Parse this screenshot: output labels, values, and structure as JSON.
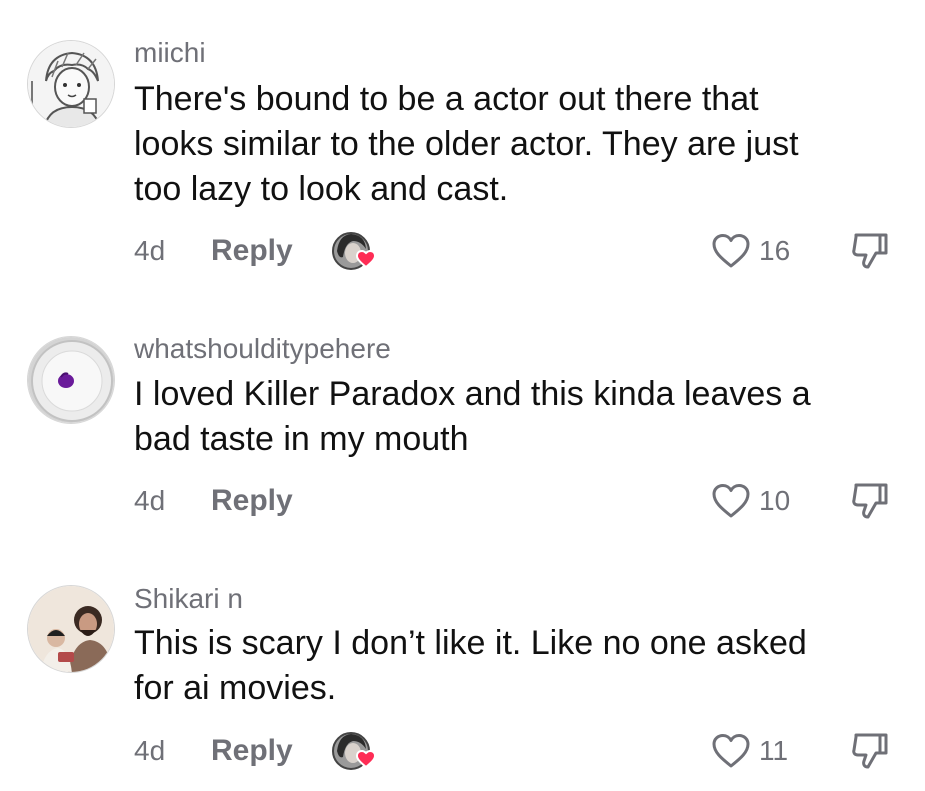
{
  "comments": [
    {
      "username": "miichi",
      "lines": [
        "There's bound to be a actor out there that",
        "looks similar to the older actor. They are just",
        "too lazy to look and cast."
      ],
      "time": "4d",
      "reply_label": "Reply",
      "likes": "16",
      "creator_liked": true,
      "avatar_icon": "manga-avatar-icon"
    },
    {
      "username": "whatshoulditypehere",
      "lines": [
        "I loved Killer Paradox and this kinda leaves a",
        "bad taste in my mouth"
      ],
      "time": "4d",
      "reply_label": "Reply",
      "likes": "10",
      "creator_liked": false,
      "avatar_icon": "plate-avatar-icon"
    },
    {
      "username": "Shikari n",
      "lines": [
        "This is scary I don’t like it. Like no one asked",
        "for ai movies."
      ],
      "time": "4d",
      "reply_label": "Reply",
      "likes": "11",
      "creator_liked": true,
      "avatar_icon": "photo-avatar-icon"
    }
  ],
  "colors": {
    "muted_text": "#6f7077",
    "body_text": "#111111",
    "heart_badge": "#fe2c55"
  },
  "icons": {
    "like": "heart-outline-icon",
    "dislike": "thumbs-down-icon",
    "creator_like": "creator-liked-badge-icon"
  }
}
